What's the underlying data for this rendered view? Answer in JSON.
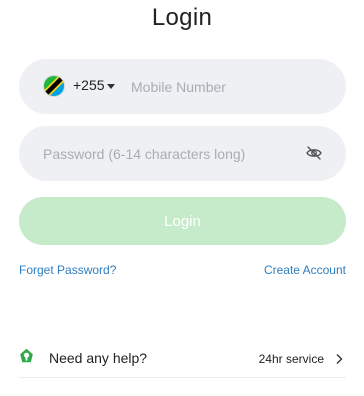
{
  "page": {
    "title": "Login"
  },
  "phone": {
    "flag_icon": "tanzania-flag-icon",
    "country_code": "+255",
    "placeholder": "Mobile Number",
    "value": ""
  },
  "password": {
    "placeholder": "Password (6-14 characters long)",
    "value": "",
    "visibility_icon": "eye-off-icon"
  },
  "login_button": {
    "label": "Login",
    "color": "#c6ebca"
  },
  "links": {
    "forgot_password": "Forget Password?",
    "create_account": "Create Account",
    "color": "#2f7ec0"
  },
  "help": {
    "icon": "support-icon",
    "label": "Need any help?",
    "service": "24hr service",
    "chevron_icon": "chevron-right-icon"
  }
}
